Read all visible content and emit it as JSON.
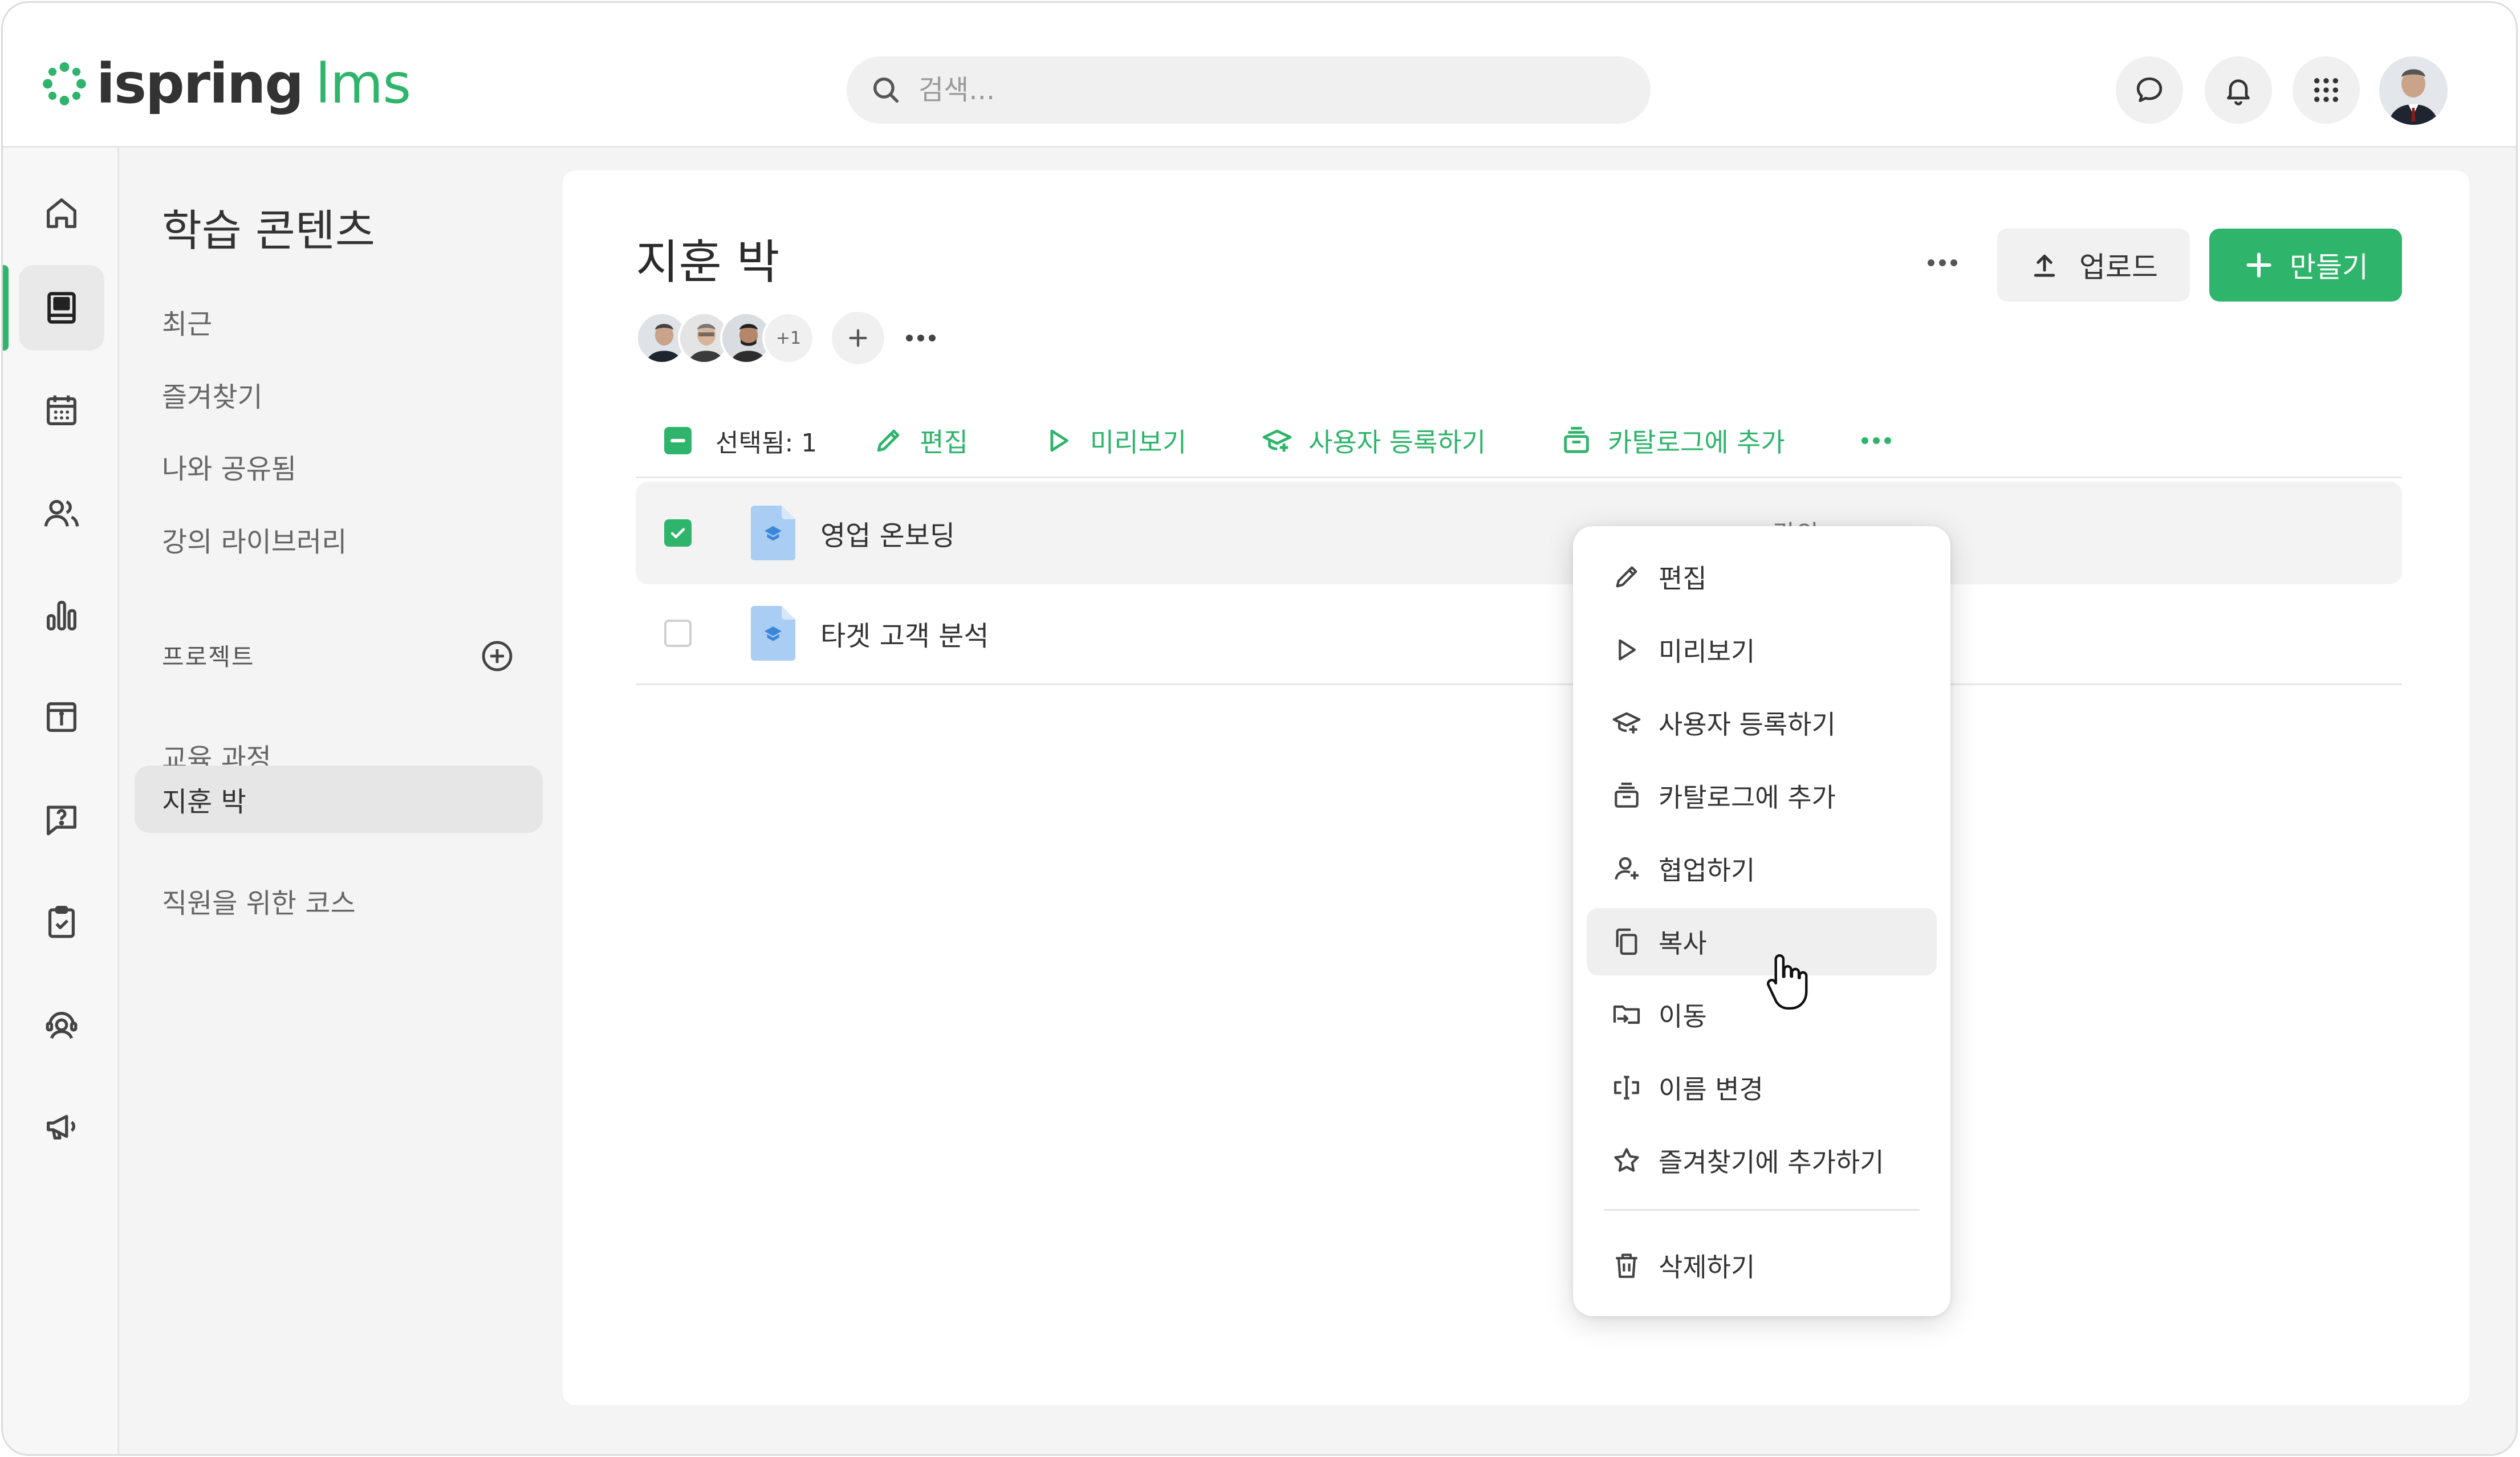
{
  "brand": {
    "name": "ispring",
    "product": "lms",
    "accent": "#2fb46c"
  },
  "header": {
    "search_placeholder": "검색...",
    "icons": [
      "chat-icon",
      "bell-icon",
      "apps-grid-icon",
      "user-avatar"
    ]
  },
  "rail": {
    "items": [
      "home-icon",
      "book-icon",
      "calendar-icon",
      "users-icon",
      "chart-icon",
      "catalog-icon",
      "help-icon",
      "clipboard-icon",
      "support-icon",
      "megaphone-icon"
    ],
    "active_index": 1
  },
  "sidebar": {
    "title": "학습 콘텐츠",
    "items": [
      {
        "label": "최근"
      },
      {
        "label": "즐겨찾기"
      },
      {
        "label": "나와 공유됨"
      },
      {
        "label": "강의 라이브러리"
      }
    ],
    "projects_label": "프로젝트",
    "projects": [
      {
        "label": "교육 과정"
      },
      {
        "label": "지훈 박",
        "active": true
      },
      {
        "label": "직원을 위한 코스"
      }
    ]
  },
  "main": {
    "title": "지훈 박",
    "collaborators_more": "+1",
    "upload_label": "업로드",
    "create_label": "만들기",
    "toolbar": {
      "selected": "선택됨: 1",
      "edit": "편집",
      "preview": "미리보기",
      "enroll": "사용자 등록하기",
      "add_catalog": "카탈로그에 추가"
    },
    "rows": [
      {
        "name": "영업 온보딩",
        "type": "강의",
        "checked": true
      },
      {
        "name": "타겟 고객 분석",
        "checked": false
      }
    ]
  },
  "context_menu": {
    "items": [
      {
        "label": "편집",
        "icon": "pencil-icon"
      },
      {
        "label": "미리보기",
        "icon": "play-icon"
      },
      {
        "label": "사용자 등록하기",
        "icon": "graduation-icon"
      },
      {
        "label": "카탈로그에 추가",
        "icon": "catalog-icon"
      },
      {
        "label": "협업하기",
        "icon": "user-plus-icon"
      },
      {
        "label": "복사",
        "icon": "copy-icon",
        "hover": true
      },
      {
        "label": "이동",
        "icon": "move-folder-icon"
      },
      {
        "label": "이름 변경",
        "icon": "rename-icon"
      },
      {
        "label": "즐겨찾기에 추가하기",
        "icon": "star-icon"
      },
      {
        "label": "삭제하기",
        "icon": "trash-icon"
      }
    ]
  }
}
